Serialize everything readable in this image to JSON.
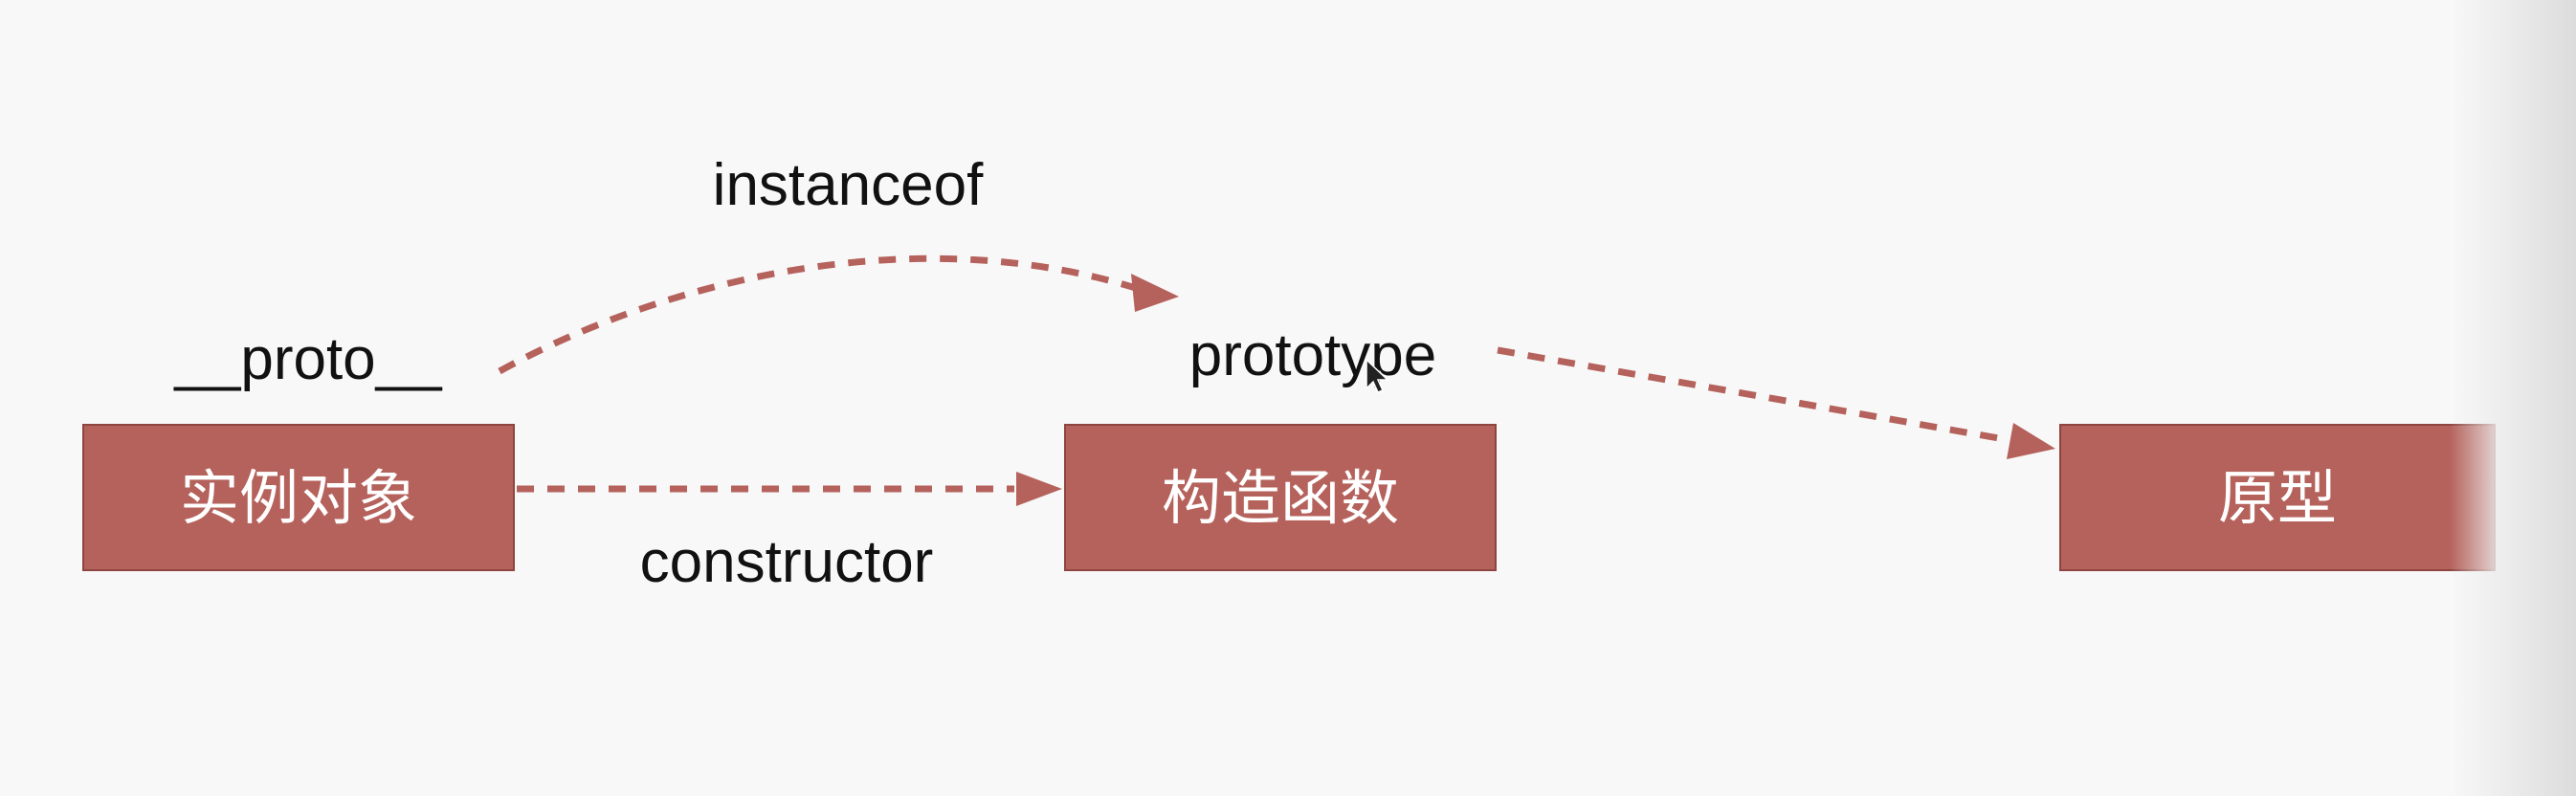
{
  "diagram": {
    "nodes": {
      "instance": {
        "label": "实例对象"
      },
      "constructor_fn": {
        "label": "构造函数"
      },
      "prototype_obj": {
        "label": "原型"
      }
    },
    "edges": {
      "constructor": {
        "from": "instance",
        "to": "constructor_fn",
        "label": "constructor"
      },
      "proto": {
        "from": "instance",
        "to": "constructor_fn",
        "label": "instanceof"
      },
      "prototype": {
        "from": "constructor_fn",
        "to": "prototype_obj",
        "label": "prototype"
      }
    },
    "extra_labels": {
      "proto_label": "__proto__"
    },
    "colors": {
      "node_fill": "#b5625c",
      "node_border": "#8e4540",
      "edge_color": "#b5625c",
      "label_color": "#111111",
      "background": "#f8f8f8"
    }
  }
}
